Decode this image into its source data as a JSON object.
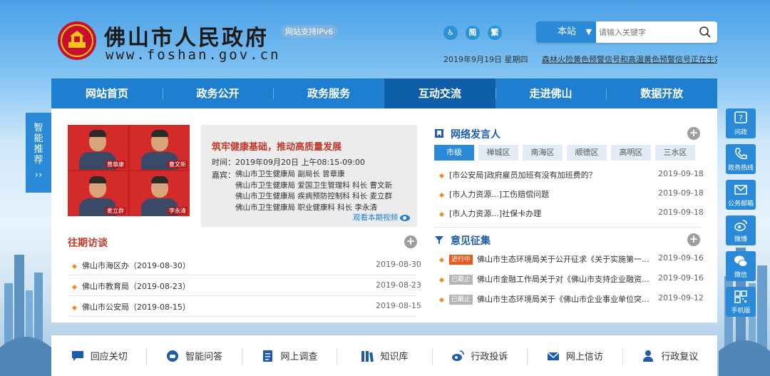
{
  "header": {
    "title": "佛山市人民政府",
    "url": "www.foshan.gov.cn",
    "ipv6_badge": "网站支持IPv6",
    "accessibility_icons": [
      "♿",
      "简",
      "繁"
    ],
    "search": {
      "scope": "本站",
      "placeholder": "请输入关键字"
    },
    "date": "2019年9月19日 星期四",
    "alert": "森林火险黄色预警信号和高温黄色预警信号正在生效"
  },
  "nav": {
    "items": [
      {
        "label": "网站首页"
      },
      {
        "label": "政务公开"
      },
      {
        "label": "政务服务"
      },
      {
        "label": "互动交流"
      },
      {
        "label": "走进佛山"
      },
      {
        "label": "数据开放"
      }
    ],
    "active_index": 3
  },
  "left_tab": {
    "label": "智能推荐",
    "chevron": "››"
  },
  "right_bar": [
    {
      "label": "问政",
      "icon": "question-icon"
    },
    {
      "label": "政务热线",
      "icon": "phone-icon"
    },
    {
      "label": "公务邮箱",
      "icon": "mail-icon"
    },
    {
      "label": "微博",
      "icon": "weibo-icon"
    },
    {
      "label": "微信",
      "icon": "wechat-icon"
    },
    {
      "label": "手机版",
      "icon": "qrcode-icon"
    }
  ],
  "interview": {
    "photo_names": [
      "曾章康",
      "曹文新",
      "麦立群",
      "李永清"
    ],
    "title": "筑牢健康基础，推动高质量发展",
    "time": "时间：2019年09月20日 上午08:15-09:00",
    "guests_label": "嘉宾：",
    "guests": [
      "佛山市卫生健康局 副局长 曾章康",
      "佛山市卫生健康局 爱国卫生管理科 科长 曹文新",
      "佛山市卫生健康局 疾病预防控制科 科长 麦立群",
      "佛山市卫生健康局 职业健康科 科长 李永清"
    ],
    "video_link": "观看本期视频"
  },
  "past_interviews": {
    "title": "往期访谈",
    "items": [
      {
        "text": "佛山市海区办（2019-08-30）",
        "date": "2019-08-30"
      },
      {
        "text": "佛山市教育局（2019-08-23）",
        "date": "2019-08-23"
      },
      {
        "text": "佛山市公安局（2019-08-15）",
        "date": "2019-08-15"
      }
    ]
  },
  "network_posts": {
    "title": "网络发言人",
    "tabs": [
      "市级",
      "禅城区",
      "南海区",
      "顺德区",
      "高明区",
      "三水区"
    ],
    "active_tab": 0,
    "items": [
      {
        "text": "[市公安局]政府雇员加班有没有加班费的？",
        "date": "2019-09-18"
      },
      {
        "text": "[市人力资源...]工伤赔偿问题",
        "date": "2019-09-18"
      },
      {
        "text": "[市人力资源...]社保卡办理",
        "date": "2019-09-18"
      }
    ]
  },
  "opinion": {
    "title": "意见征集",
    "items": [
      {
        "status": "进行中",
        "text": "佛山市生态环境局关于公开征求《关于实施第一...",
        "date": "2019-09-16"
      },
      {
        "status": "已截止",
        "text": "佛山市金融工作局关于对《佛山市支持企业融资...",
        "date": "2019-09-16"
      },
      {
        "status": "已截止",
        "text": "佛山市生态环境局关于《佛山市企业事业单位突...",
        "date": "2019-09-12"
      }
    ]
  },
  "bottom_bar": [
    {
      "label": "回应关切",
      "icon": "chat-icon"
    },
    {
      "label": "智能问答",
      "icon": "robot-icon"
    },
    {
      "label": "网上调查",
      "icon": "survey-icon"
    },
    {
      "label": "知识库",
      "icon": "books-icon"
    },
    {
      "label": "行政投诉",
      "icon": "complaint-icon"
    },
    {
      "label": "网上信访",
      "icon": "envelope-icon"
    },
    {
      "label": "行政复议",
      "icon": "review-icon"
    }
  ],
  "colors": {
    "nav_blue": "#1e7fd0",
    "nav_active": "#0f5fa8",
    "accent_red": "#c0392b",
    "section_blue": "#1e5ba8",
    "bullet_orange": "#f08a24",
    "status_active": "#e85a1f",
    "status_closed": "#b5b5b5"
  }
}
